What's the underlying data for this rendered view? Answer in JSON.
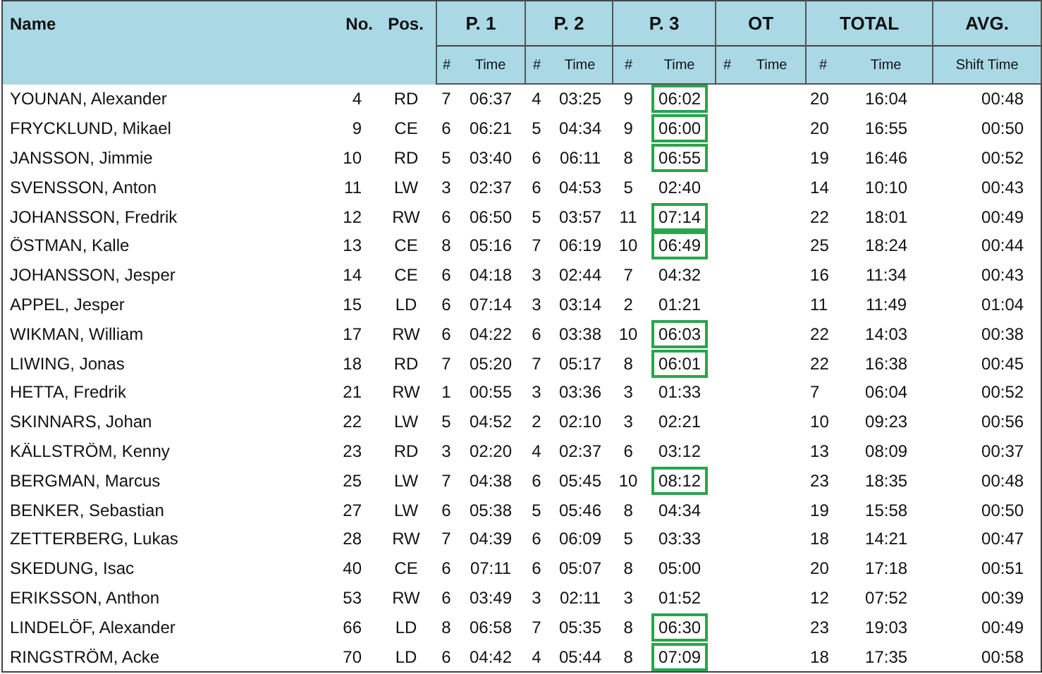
{
  "table": {
    "columns": [
      {
        "label": "Name"
      },
      {
        "label": "No."
      },
      {
        "label": "Pos."
      },
      {
        "label": "P. 1",
        "sub": [
          "#",
          "Time"
        ]
      },
      {
        "label": "P. 2",
        "sub": [
          "#",
          "Time"
        ]
      },
      {
        "label": "P. 3",
        "sub": [
          "#",
          "Time"
        ]
      },
      {
        "label": "OT",
        "sub": [
          "#",
          "Time"
        ]
      },
      {
        "label": "TOTAL",
        "sub": [
          "#",
          "Time"
        ]
      },
      {
        "label": "AVG.",
        "sub": [
          "Shift Time"
        ]
      }
    ],
    "rows": [
      {
        "name": "YOUNAN, Alexander",
        "no": "4",
        "pos": "RD",
        "p1": [
          "7",
          "06:37"
        ],
        "p2": [
          "4",
          "03:25"
        ],
        "p3": [
          "9",
          "06:02"
        ],
        "p3_highlighted": true,
        "total": [
          "20",
          "16:04"
        ],
        "avg": "00:48"
      },
      {
        "name": "FRYCKLUND, Mikael",
        "no": "9",
        "pos": "CE",
        "p1": [
          "6",
          "06:21"
        ],
        "p2": [
          "5",
          "04:34"
        ],
        "p3": [
          "9",
          "06:00"
        ],
        "p3_highlighted": true,
        "total": [
          "20",
          "16:55"
        ],
        "avg": "00:50"
      },
      {
        "name": "JANSSON, Jimmie",
        "no": "10",
        "pos": "RD",
        "p1": [
          "5",
          "03:40"
        ],
        "p2": [
          "6",
          "06:11"
        ],
        "p3": [
          "8",
          "06:55"
        ],
        "p3_highlighted": true,
        "total": [
          "19",
          "16:46"
        ],
        "avg": "00:52"
      },
      {
        "name": "SVENSSON, Anton",
        "no": "11",
        "pos": "LW",
        "p1": [
          "3",
          "02:37"
        ],
        "p2": [
          "6",
          "04:53"
        ],
        "p3": [
          "5",
          "02:40"
        ],
        "p3_highlighted": false,
        "total": [
          "14",
          "10:10"
        ],
        "avg": "00:43"
      },
      {
        "name": "JOHANSSON, Fredrik",
        "no": "12",
        "pos": "RW",
        "p1": [
          "6",
          "06:50"
        ],
        "p2": [
          "5",
          "03:57"
        ],
        "p3": [
          "11",
          "07:14"
        ],
        "p3_highlighted": true,
        "total": [
          "22",
          "18:01"
        ],
        "avg": "00:49"
      },
      {
        "name": "ÖSTMAN, Kalle",
        "no": "13",
        "pos": "CE",
        "p1": [
          "8",
          "05:16"
        ],
        "p2": [
          "7",
          "06:19"
        ],
        "p3": [
          "10",
          "06:49"
        ],
        "p3_highlighted": true,
        "total": [
          "25",
          "18:24"
        ],
        "avg": "00:44"
      },
      {
        "name": "JOHANSSON, Jesper",
        "no": "14",
        "pos": "CE",
        "p1": [
          "6",
          "04:18"
        ],
        "p2": [
          "3",
          "02:44"
        ],
        "p3": [
          "7",
          "04:32"
        ],
        "p3_highlighted": false,
        "total": [
          "16",
          "11:34"
        ],
        "avg": "00:43"
      },
      {
        "name": "APPEL, Jesper",
        "no": "15",
        "pos": "LD",
        "p1": [
          "6",
          "07:14"
        ],
        "p2": [
          "3",
          "03:14"
        ],
        "p3": [
          "2",
          "01:21"
        ],
        "p3_highlighted": false,
        "total": [
          "11",
          "11:49"
        ],
        "avg": "01:04"
      },
      {
        "name": "WIKMAN, William",
        "no": "17",
        "pos": "RW",
        "p1": [
          "6",
          "04:22"
        ],
        "p2": [
          "6",
          "03:38"
        ],
        "p3": [
          "10",
          "06:03"
        ],
        "p3_highlighted": true,
        "total": [
          "22",
          "14:03"
        ],
        "avg": "00:38"
      },
      {
        "name": "LIWING, Jonas",
        "no": "18",
        "pos": "RD",
        "p1": [
          "7",
          "05:20"
        ],
        "p2": [
          "7",
          "05:17"
        ],
        "p3": [
          "8",
          "06:01"
        ],
        "p3_highlighted": true,
        "total": [
          "22",
          "16:38"
        ],
        "avg": "00:45"
      },
      {
        "name": "HETTA, Fredrik",
        "no": "21",
        "pos": "RW",
        "p1": [
          "1",
          "00:55"
        ],
        "p2": [
          "3",
          "03:36"
        ],
        "p3": [
          "3",
          "01:33"
        ],
        "p3_highlighted": false,
        "total": [
          "7",
          "06:04"
        ],
        "avg": "00:52"
      },
      {
        "name": "SKINNARS, Johan",
        "no": "22",
        "pos": "LW",
        "p1": [
          "5",
          "04:52"
        ],
        "p2": [
          "2",
          "02:10"
        ],
        "p3": [
          "3",
          "02:21"
        ],
        "p3_highlighted": false,
        "total": [
          "10",
          "09:23"
        ],
        "avg": "00:56"
      },
      {
        "name": "KÄLLSTRÖM, Kenny",
        "no": "23",
        "pos": "RD",
        "p1": [
          "3",
          "02:20"
        ],
        "p2": [
          "4",
          "02:37"
        ],
        "p3": [
          "6",
          "03:12"
        ],
        "p3_highlighted": false,
        "total": [
          "13",
          "08:09"
        ],
        "avg": "00:37"
      },
      {
        "name": "BERGMAN, Marcus",
        "no": "25",
        "pos": "LW",
        "p1": [
          "7",
          "04:38"
        ],
        "p2": [
          "6",
          "05:45"
        ],
        "p3": [
          "10",
          "08:12"
        ],
        "p3_highlighted": true,
        "total": [
          "23",
          "18:35"
        ],
        "avg": "00:48"
      },
      {
        "name": "BENKER, Sebastian",
        "no": "27",
        "pos": "LW",
        "p1": [
          "6",
          "05:38"
        ],
        "p2": [
          "5",
          "05:46"
        ],
        "p3": [
          "8",
          "04:34"
        ],
        "p3_highlighted": false,
        "total": [
          "19",
          "15:58"
        ],
        "avg": "00:50"
      },
      {
        "name": "ZETTERBERG, Lukas",
        "no": "28",
        "pos": "RW",
        "p1": [
          "7",
          "04:39"
        ],
        "p2": [
          "6",
          "06:09"
        ],
        "p3": [
          "5",
          "03:33"
        ],
        "p3_highlighted": false,
        "total": [
          "18",
          "14:21"
        ],
        "avg": "00:47"
      },
      {
        "name": "SKEDUNG, Isac",
        "no": "40",
        "pos": "CE",
        "p1": [
          "6",
          "07:11"
        ],
        "p2": [
          "6",
          "05:07"
        ],
        "p3": [
          "8",
          "05:00"
        ],
        "p3_highlighted": false,
        "total": [
          "20",
          "17:18"
        ],
        "avg": "00:51"
      },
      {
        "name": "ERIKSSON, Anthon",
        "no": "53",
        "pos": "RW",
        "p1": [
          "6",
          "03:49"
        ],
        "p2": [
          "3",
          "02:11"
        ],
        "p3": [
          "3",
          "01:52"
        ],
        "p3_highlighted": false,
        "total": [
          "12",
          "07:52"
        ],
        "avg": "00:39"
      },
      {
        "name": "LINDELÖF, Alexander",
        "no": "66",
        "pos": "LD",
        "p1": [
          "8",
          "06:58"
        ],
        "p2": [
          "7",
          "05:35"
        ],
        "p3": [
          "8",
          "06:30"
        ],
        "p3_highlighted": true,
        "total": [
          "23",
          "19:03"
        ],
        "avg": "00:49"
      },
      {
        "name": "RINGSTRÖM, Acke",
        "no": "70",
        "pos": "LD",
        "p1": [
          "6",
          "04:42"
        ],
        "p2": [
          "4",
          "05:44"
        ],
        "p3": [
          "8",
          "07:09"
        ],
        "p3_highlighted": true,
        "total": [
          "18",
          "17:35"
        ],
        "avg": "00:58"
      }
    ]
  }
}
